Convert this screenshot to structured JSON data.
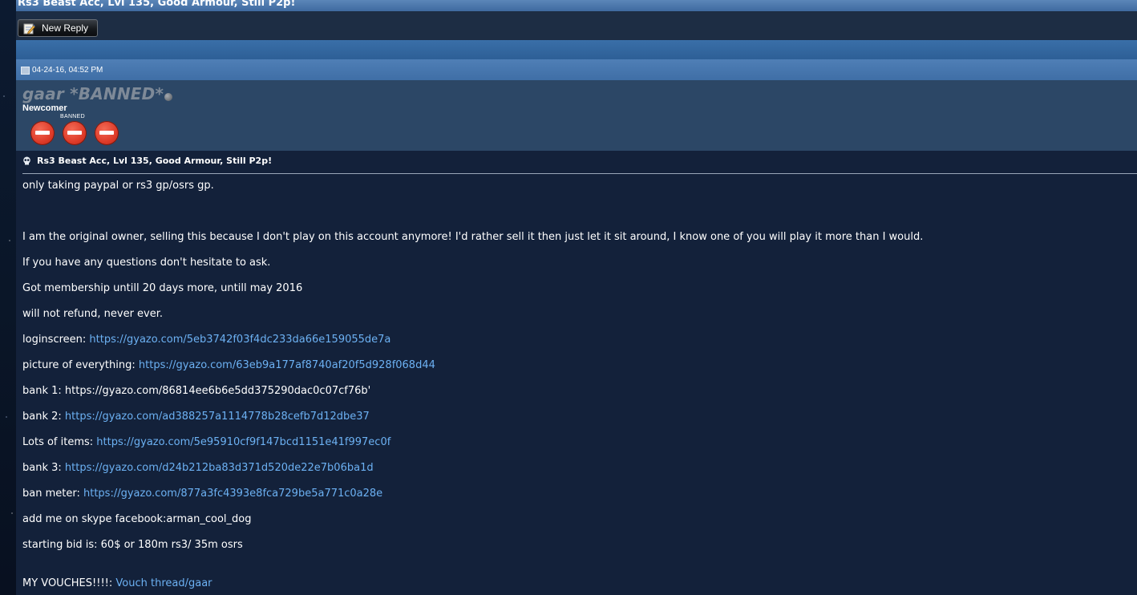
{
  "thread": {
    "title": "Rs3 Beast Acc, Lvl 135, Good Armour, Still P2p!"
  },
  "toolbar": {
    "new_reply_label": "New Reply"
  },
  "post": {
    "date": "04-24-16, 04:52 PM",
    "title": "Rs3 Beast Acc, Lvl 135, Good Armour, Still P2p!",
    "author": {
      "username": "gaar *BANNED*",
      "status": "offline",
      "title": "Newcomer",
      "badge_label": "BANNED",
      "badge_icons": [
        "ban-icon",
        "ban-icon",
        "ban-icon"
      ]
    },
    "lines": [
      {
        "text": "only taking paypal or rs3 gp/osrs gp."
      },
      {
        "text": "I am the original owner, selling this because I don't play on this account anymore! I'd rather sell it then just let it sit around, I know one of you will play it more than I would."
      },
      {
        "text": "If you have any questions don't hesitate to ask."
      },
      {
        "text": "Got membership untill 20 days more, untill may 2016"
      },
      {
        "text": "will not refund, never ever."
      },
      {
        "label": "loginscreen: ",
        "link": "https://gyazo.com/5eb3742f03f4dc233da66e159055de7a"
      },
      {
        "label": "picture of everything: ",
        "link": "https://gyazo.com/63eb9a177af8740af20f5d928f068d44"
      },
      {
        "text": "bank 1: https://gyazo.com/86814ee6b6e5dd375290dac0c07cf76b'"
      },
      {
        "label": "bank 2: ",
        "link": "https://gyazo.com/ad388257a1114778b28cefb7d12dbe37"
      },
      {
        "label": "Lots of items: ",
        "link": "https://gyazo.com/5e95910cf9f147bcd1151e41f997ec0f"
      },
      {
        "label": "bank 3: ",
        "link": "https://gyazo.com/d24b212ba83d371d520de22e7b06ba1d"
      },
      {
        "label": "ban meter: ",
        "link": "https://gyazo.com/877a3fc4393e8fca729be5a771c0a28e"
      },
      {
        "text": "add me on skype facebook:arman_cool_dog"
      },
      {
        "text": "starting bid is: 60$ or 180m rs3/ 35m osrs"
      },
      {
        "label": "MY VOUCHES!!!!: ",
        "link": "Vouch thread/gaar"
      }
    ]
  },
  "colors": {
    "link": "#6cb1f3",
    "post_bg": "#13213a",
    "user_panel_bg": "#2c4766",
    "header_blue": "#3f6ea6"
  }
}
